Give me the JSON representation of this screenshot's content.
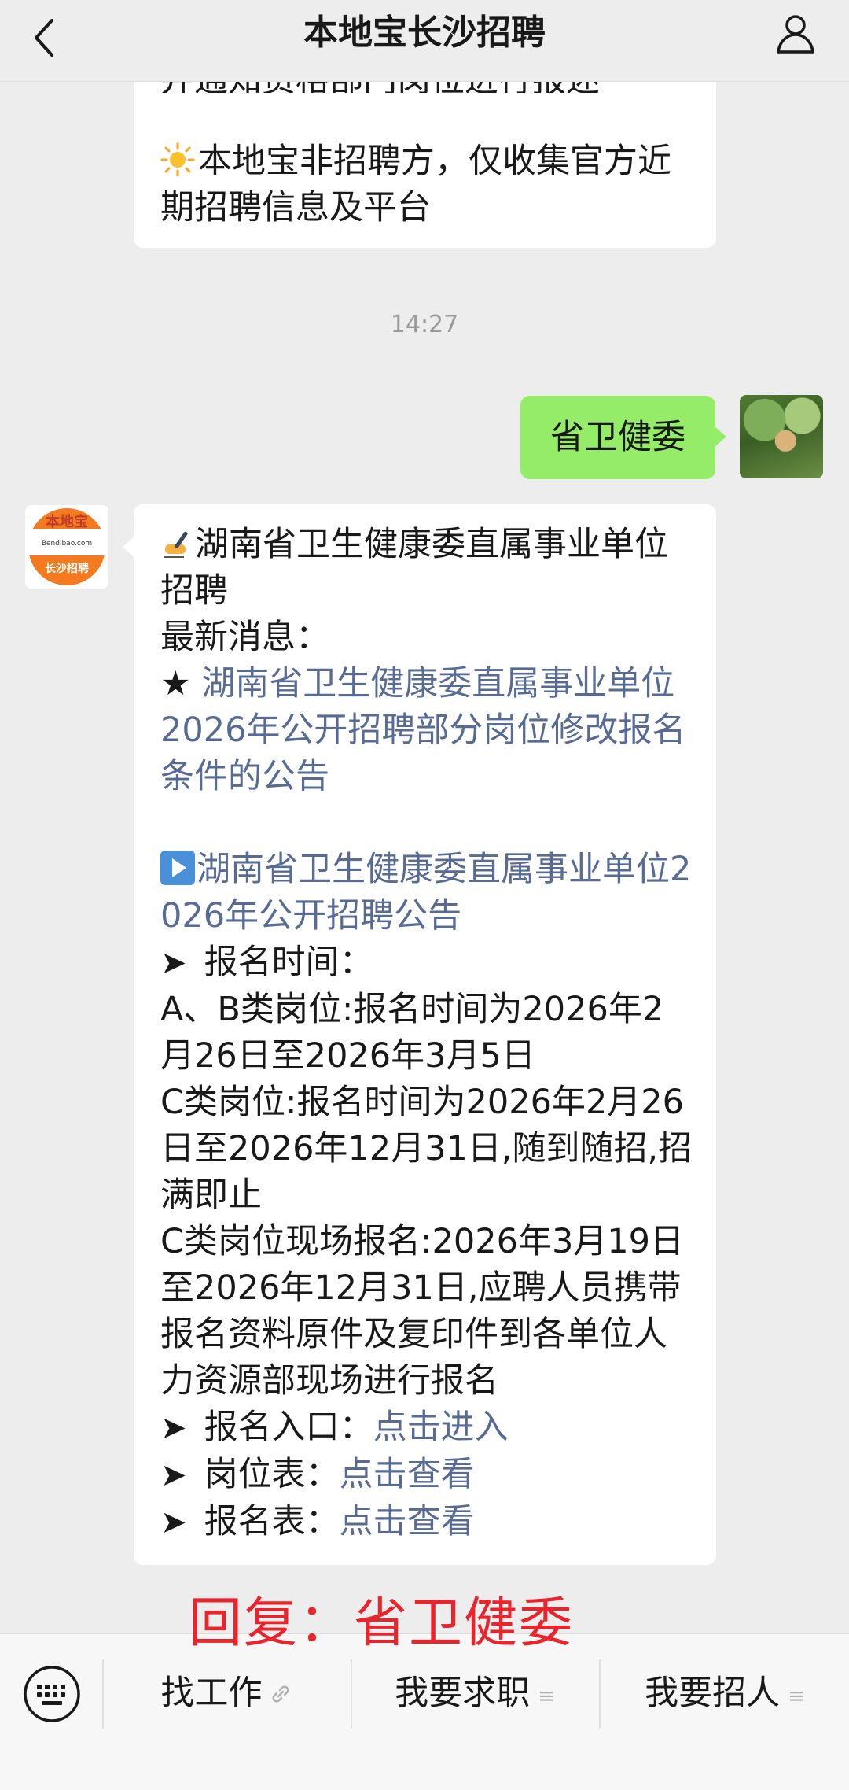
{
  "header": {
    "title": "本地宝长沙招聘"
  },
  "messages": {
    "top_partial_text": "并通知资格部门岗位进行报述",
    "top_notice": "本地宝非招聘方，仅收集官方近期招聘信息及平台",
    "timestamp": "14:27",
    "user_message": "省卫健委",
    "bot": {
      "avatar_logo": "本地宝",
      "avatar_sub": "Bendibao.com",
      "avatar_city": "长沙招聘",
      "title": "湖南省卫生健康委直属事业单位招聘",
      "latest_label": "最新消息：",
      "latest_star": "★",
      "latest_link": "湖南省卫生健康委直属事业单位2026年公开招聘部分岗位修改报名条件的公告",
      "announce_link": "湖南省卫生健康委直属事业单位2026年公开招聘公告",
      "arrow": "➤",
      "reg_time_label": "报名时间：",
      "reg_time_ab": "A、B类岗位:报名时间为2026年2月26日至2026年3月5日",
      "reg_time_c": "C类岗位:报名时间为2026年2月26日至2026年12月31日,随到随招,招满即止",
      "reg_onsite_c": "C类岗位现场报名:2026年3月19日至2026年12月31日,应聘人员携带报名资料原件及复印件到各单位人力资源部现场进行报名",
      "entry_label": "报名入口：",
      "entry_link": "点击进入",
      "posts_label": "岗位表：",
      "posts_link": "点击查看",
      "form_label": "报名表：",
      "form_link": "点击查看"
    }
  },
  "overlay": {
    "reply_hint": "回复：省卫健委"
  },
  "bottom_menu": {
    "item1": "找工作",
    "item2": "我要求职",
    "item3": "我要招人",
    "menu_mark": "≡"
  },
  "colors": {
    "background": "#ededed",
    "bubble_user": "#95ec69",
    "link": "#576b95",
    "overlay_red": "#e8242c"
  },
  "icons": {
    "back": "chevron-left-icon",
    "profile": "person-icon",
    "keyboard": "keyboard-icon",
    "link": "link-icon",
    "sun": "sun-emoji-icon",
    "writing": "writing-hand-emoji-icon",
    "play": "play-button-emoji-icon"
  }
}
